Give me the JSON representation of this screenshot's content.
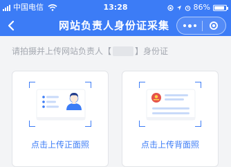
{
  "status_bar": {
    "carrier": "中国电信",
    "time": "13:28",
    "battery": "86%",
    "battery_level": 0.86
  },
  "nav": {
    "title": "网站负责人身份证采集",
    "back_icon": "chevron-left-icon",
    "more_icon": "more-dots-icon",
    "close_icon": "target-close-icon"
  },
  "instruction": {
    "before": "请拍摄并上传网站负责人【",
    "after": "】身份证"
  },
  "cards": {
    "front_label": "点击上传正面照",
    "back_label": "点击上传背面照"
  },
  "colors": {
    "primary": "#3c7cf6",
    "emblem": "#e5534b",
    "line_light": "#c8daf9"
  }
}
